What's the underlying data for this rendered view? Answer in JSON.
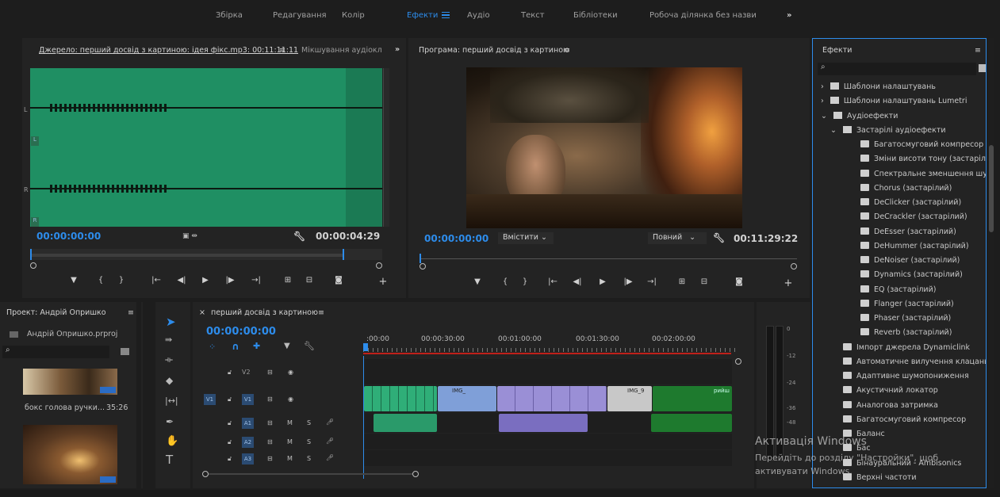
{
  "workspaces": [
    "Збірка",
    "Редагування",
    "Колір",
    "Ефекти",
    "Аудіо",
    "Текст",
    "Бібліотеки",
    "Робоча ділянка без назви"
  ],
  "active_workspace": "Ефекти",
  "overflow_icon": "»",
  "source": {
    "tab_title": "Джерело: перший досвід з картиною: ідея фікс.mp3: 00:11:11:11",
    "tab2": "Мікшування аудіокл",
    "channel_L": "L",
    "channel_R": "R",
    "time_in": "00:00:00:00",
    "duration": "00:00:04:29"
  },
  "program": {
    "title": "Програма: перший досвід з картиною",
    "time": "00:00:00:00",
    "fit": "Вмістити",
    "quality": "Повний",
    "duration": "00:11:29:22"
  },
  "project": {
    "title": "Проект: Андрій Опришко",
    "file": "Андрій Опришко.prproj",
    "clip1_name": "бокс голова ручки...",
    "clip1_dur": "35:26"
  },
  "timeline": {
    "title": "перший досвід з картиною",
    "time": "00:00:00:00",
    "ruler": [
      ":00:00",
      "00:00:30:00",
      "00:01:00:00",
      "00:01:30:00",
      "00:02:00:00"
    ],
    "tracks": [
      {
        "name": "V2",
        "src": ""
      },
      {
        "name": "V1",
        "src": "V1"
      },
      {
        "name": "A1",
        "src": "",
        "m": "M",
        "s": "S"
      },
      {
        "name": "A2",
        "src": "",
        "m": "M",
        "s": "S"
      },
      {
        "name": "A3",
        "src": "",
        "m": "M",
        "s": "S"
      }
    ],
    "clip_labels": [
      "IMG_",
      "IMG_9",
      "рийш"
    ]
  },
  "meter": {
    "ticks": [
      "0",
      "-12",
      "-24",
      "-36",
      "-48"
    ]
  },
  "effects": {
    "title": "Ефекти",
    "items": [
      {
        "label": "Шаблони налаштувань",
        "level": 0,
        "kind": "folder",
        "arrow": "›"
      },
      {
        "label": "Шаблони налаштувань Lumetri",
        "level": 0,
        "kind": "folder",
        "arrow": "›"
      },
      {
        "label": "Аудіоефекти",
        "level": 0,
        "kind": "folder",
        "arrow": "⌄"
      },
      {
        "label": "Застарілі аудіоефекти",
        "level": 1,
        "kind": "folder",
        "arrow": "⌄"
      },
      {
        "label": "Багатосмуговий компресор (зас",
        "level": 2,
        "kind": "fx"
      },
      {
        "label": "Зміни висоти тону (застарілий)",
        "level": 2,
        "kind": "fx"
      },
      {
        "label": "Спектральне зменшення шуму (",
        "level": 2,
        "kind": "fx"
      },
      {
        "label": "Chorus (застарілий)",
        "level": 2,
        "kind": "fx"
      },
      {
        "label": "DeClicker (застарілий)",
        "level": 2,
        "kind": "fx"
      },
      {
        "label": "DeCrackler (застарілий)",
        "level": 2,
        "kind": "fx"
      },
      {
        "label": "DeEsser (застарілий)",
        "level": 2,
        "kind": "fx"
      },
      {
        "label": "DeHummer (застарілий)",
        "level": 2,
        "kind": "fx"
      },
      {
        "label": "DeNoiser (застарілий)",
        "level": 2,
        "kind": "fx"
      },
      {
        "label": "Dynamics (застарілий)",
        "level": 2,
        "kind": "fx"
      },
      {
        "label": "EQ (застарілий)",
        "level": 2,
        "kind": "fx"
      },
      {
        "label": "Flanger (застарілий)",
        "level": 2,
        "kind": "fx"
      },
      {
        "label": "Phaser (застарілий)",
        "level": 2,
        "kind": "fx"
      },
      {
        "label": "Reverb (застарілий)",
        "level": 2,
        "kind": "fx"
      },
      {
        "label": "Імпорт джерела Dynamiclink",
        "level": 1,
        "kind": "fx"
      },
      {
        "label": "Автоматичне вилучення клацань",
        "level": 1,
        "kind": "fx"
      },
      {
        "label": "Адаптивне шумопониження",
        "level": 1,
        "kind": "fx"
      },
      {
        "label": "Акустичний локатор",
        "level": 1,
        "kind": "fx"
      },
      {
        "label": "Аналогова затримка",
        "level": 1,
        "kind": "fx"
      },
      {
        "label": "Багатосмуговий компресор",
        "level": 1,
        "kind": "fx"
      },
      {
        "label": "Баланс",
        "level": 1,
        "kind": "fx"
      },
      {
        "label": "Бас",
        "level": 1,
        "kind": "fx"
      },
      {
        "label": "Бінауральний - Ambisonics",
        "level": 1,
        "kind": "fx"
      },
      {
        "label": "Верхні частоти",
        "level": 1,
        "kind": "fx"
      }
    ]
  },
  "watermark": {
    "line1": "Активація Windows",
    "line2": "Перейдіть до розділу \"Настройки\", щоб",
    "line3": "активувати Windows."
  },
  "colors": {
    "accent": "#2d8ceb",
    "waveform_bg": "#1f8f63",
    "clip_green": "#2fae78",
    "clip_purple": "#9a8fd6",
    "clip_blue": "#7f9fd8",
    "clip_darkgreen": "#1e7a2e"
  }
}
